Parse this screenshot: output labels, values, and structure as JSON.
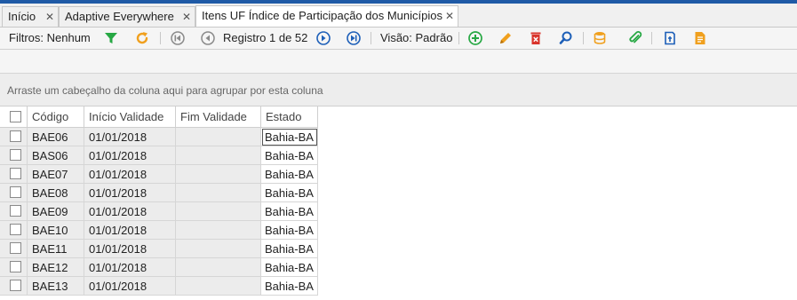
{
  "tabs": [
    {
      "label": "Início",
      "closable": true,
      "active": false
    },
    {
      "label": "Adaptive Everywhere",
      "closable": true,
      "active": false
    },
    {
      "label": "Itens UF Índice de Participação dos Municípios",
      "closable": true,
      "active": true
    }
  ],
  "close_glyph": "✕",
  "toolbar": {
    "filters_label": "Filtros: Nenhum",
    "record_label": "Registro 1 de 52",
    "view_label": "Visão: Padrão",
    "icons": [
      "filter-icon",
      "refresh-icon",
      "first-record-icon",
      "previous-record-icon",
      "next-record-icon",
      "last-record-icon",
      "add-icon",
      "edit-icon",
      "delete-icon",
      "search-icon",
      "database-icon",
      "attach-icon",
      "export-icon",
      "report-icon"
    ]
  },
  "group_hint": "Arraste um cabeçalho da coluna aqui para agrupar por esta coluna",
  "grid": {
    "columns": [
      "Código",
      "Início Validade",
      "Fim Validade",
      "Estado"
    ],
    "rows": [
      {
        "codigo": "BAE06",
        "inicio": "01/01/2018",
        "fim": "",
        "estado": "Bahia-BA"
      },
      {
        "codigo": "BAS06",
        "inicio": "01/01/2018",
        "fim": "",
        "estado": "Bahia-BA"
      },
      {
        "codigo": "BAE07",
        "inicio": "01/01/2018",
        "fim": "",
        "estado": "Bahia-BA"
      },
      {
        "codigo": "BAE08",
        "inicio": "01/01/2018",
        "fim": "",
        "estado": "Bahia-BA"
      },
      {
        "codigo": "BAE09",
        "inicio": "01/01/2018",
        "fim": "",
        "estado": "Bahia-BA"
      },
      {
        "codigo": "BAE10",
        "inicio": "01/01/2018",
        "fim": "",
        "estado": "Bahia-BA"
      },
      {
        "codigo": "BAE11",
        "inicio": "01/01/2018",
        "fim": "",
        "estado": "Bahia-BA"
      },
      {
        "codigo": "BAE12",
        "inicio": "01/01/2018",
        "fim": "",
        "estado": "Bahia-BA"
      },
      {
        "codigo": "BAE13",
        "inicio": "01/01/2018",
        "fim": "",
        "estado": "Bahia-BA"
      }
    ]
  },
  "colors": {
    "accent": "#1f5aa6",
    "green": "#27a844",
    "orange": "#f0a01e",
    "red": "#d9342b",
    "blue": "#1d5fb8"
  }
}
